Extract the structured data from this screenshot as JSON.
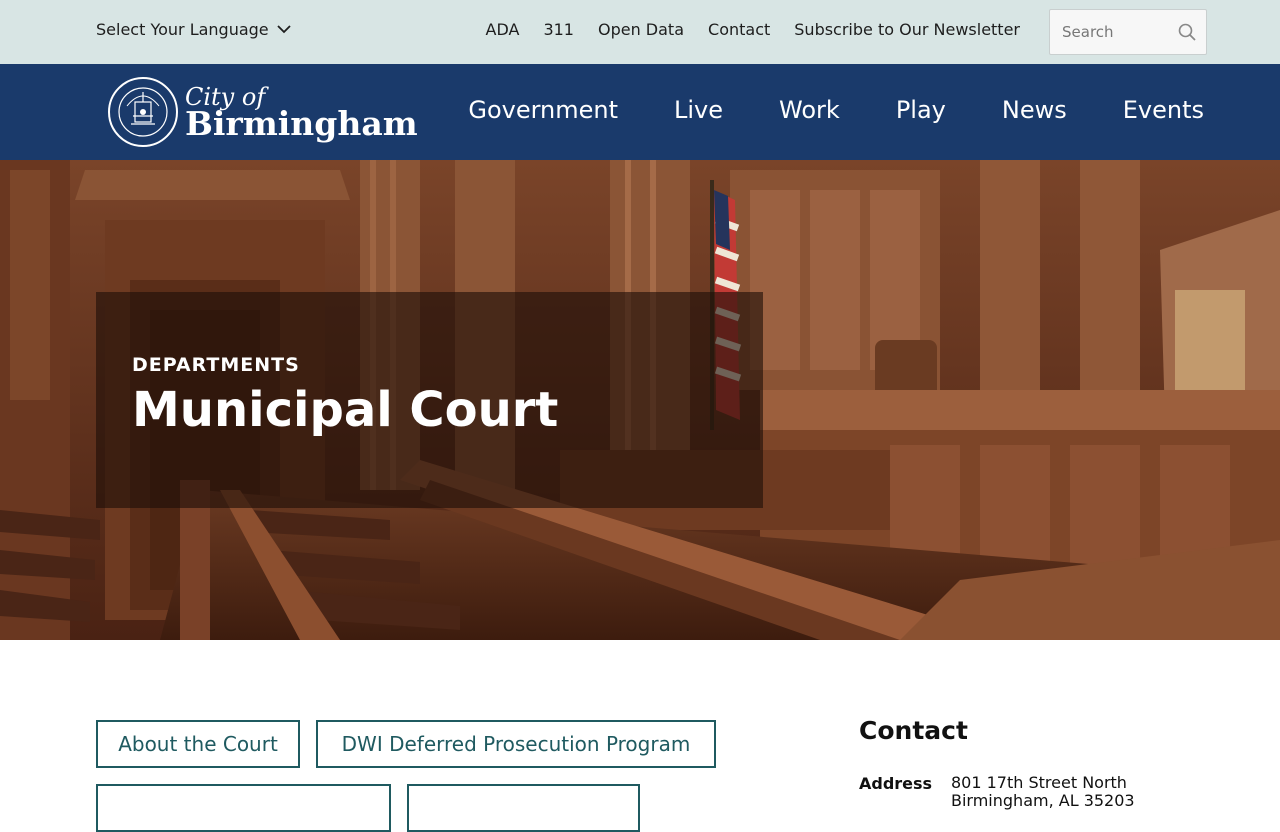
{
  "utility": {
    "language_label": "Select Your Language",
    "links": [
      "ADA",
      "311",
      "Open Data",
      "Contact",
      "Subscribe to Our Newsletter"
    ],
    "search_placeholder": "Search"
  },
  "header": {
    "logo_line1": "City of",
    "logo_line2": "Birmingham",
    "nav": [
      "Government",
      "Live",
      "Work",
      "Play",
      "News",
      "Events"
    ]
  },
  "hero": {
    "eyebrow": "DEPARTMENTS",
    "title": "Municipal Court"
  },
  "quick_links": [
    "About the Court",
    "DWI Deferred Prosecution Program"
  ],
  "contact": {
    "title": "Contact",
    "address_label": "Address",
    "address_line1": "801 17th Street North",
    "address_line2": "Birmingham, AL 35203"
  },
  "colors": {
    "utility_bg": "#d8e5e4",
    "header_bg": "#1a3a6b",
    "button_accent": "#1f5a60"
  }
}
